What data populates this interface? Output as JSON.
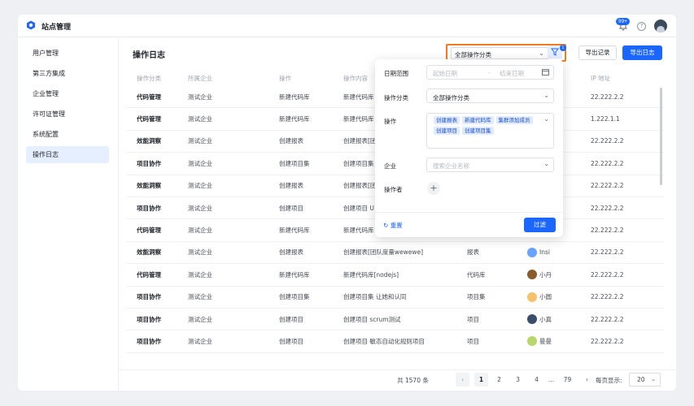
{
  "app": {
    "title": "站点管理",
    "notify_count": "99+",
    "help_glyph": "?"
  },
  "sidebar": {
    "items": [
      {
        "label": "用户管理"
      },
      {
        "label": "第三方集成"
      },
      {
        "label": "企业管理"
      },
      {
        "label": "许可证管理"
      },
      {
        "label": "系统配置"
      },
      {
        "label": "操作日志",
        "active": true
      }
    ]
  },
  "page": {
    "title": "操作日志"
  },
  "toolbar": {
    "category_value": "全部操作分类",
    "filter_count": "1",
    "export_log": "导出记录",
    "export_daily": "导出日志"
  },
  "table": {
    "headers": [
      "操作分类",
      "所属企业",
      "操作",
      "操作内容",
      "",
      "",
      "IP 地址"
    ],
    "rows": [
      {
        "cat": "代码管理",
        "ent": "测试企业",
        "op": "新建代码库",
        "content": "新建代码库",
        "obj": "",
        "user": "",
        "ip": "22.222.2.2"
      },
      {
        "cat": "代码管理",
        "ent": "测试企业",
        "op": "新建代码库",
        "content": "新建代码库",
        "obj": "",
        "user": "",
        "ip": "1.222.1.1"
      },
      {
        "cat": "效能洞察",
        "ent": "测试企业",
        "op": "创建报表",
        "content": "创建报表[团",
        "obj": "",
        "user": "",
        "ip": "22.222.2.2"
      },
      {
        "cat": "项目协作",
        "ent": "测试企业",
        "op": "创建项目集",
        "content": "创建项目集",
        "obj": "",
        "user": "",
        "ip": "22.222.2.2"
      },
      {
        "cat": "效能洞察",
        "ent": "测试企业",
        "op": "创建报表",
        "content": "创建报表[团",
        "obj": "",
        "user": "",
        "ip": "22.222.2.2"
      },
      {
        "cat": "项目协作",
        "ent": "测试企业",
        "op": "创建项目",
        "content": "创建项目 U",
        "obj": "",
        "user": "",
        "ip": "22.222.2.2"
      },
      {
        "cat": "代码管理",
        "ent": "测试企业",
        "op": "新建代码库",
        "content": "新建代码库",
        "obj": "",
        "user": "",
        "ip": "22.222.2.2"
      },
      {
        "cat": "效能洞察",
        "ent": "测试企业",
        "op": "创建报表",
        "content": "创建报表[团队度量wewewe]",
        "obj": "报表",
        "user": "Insi",
        "ip": "22.222.2.2"
      },
      {
        "cat": "代码管理",
        "ent": "测试企业",
        "op": "新建代码库",
        "content": "新建代码库[nodejs]",
        "obj": "代码库",
        "user": "小丹",
        "ip": "22.222.2.2"
      },
      {
        "cat": "项目协作",
        "ent": "测试企业",
        "op": "创建项目集",
        "content": "创建项目集 让她和认同",
        "obj": "项目集",
        "user": "小圆",
        "ip": "22.222.2.2"
      },
      {
        "cat": "项目协作",
        "ent": "测试企业",
        "op": "创建项目",
        "content": "创建项目 scrum测试",
        "obj": "项目",
        "user": "小真",
        "ip": "22.222.2.2"
      },
      {
        "cat": "项目协作",
        "ent": "测试企业",
        "op": "创建项目",
        "content": "创建项目 敏态自动化规则项目",
        "obj": "项目",
        "user": "曼曼",
        "ip": "22.222.2.2"
      }
    ]
  },
  "pagination": {
    "total": "共 1570 条",
    "pages": [
      "1",
      "2",
      "3",
      "4",
      "...",
      "79"
    ],
    "page_size_label": "每页显示:",
    "page_size": "20"
  },
  "filter_popover": {
    "date_label": "日期范围",
    "date_start_ph": "起始日期",
    "date_sep": "-",
    "date_end_ph": "结束日期",
    "cat_label": "操作分类",
    "cat_value": "全部操作分类",
    "op_label": "操作",
    "op_tags": [
      "创建报表",
      "新建代码库",
      "集群添加成员",
      "创建项目",
      "创建项目集"
    ],
    "ent_label": "企业",
    "ent_ph": "搜索企业名称",
    "operator_label": "操作者",
    "reset": "重置",
    "apply": "过滤"
  },
  "colors": {
    "primary": "#1a66ff",
    "highlight": "#f07c22"
  }
}
